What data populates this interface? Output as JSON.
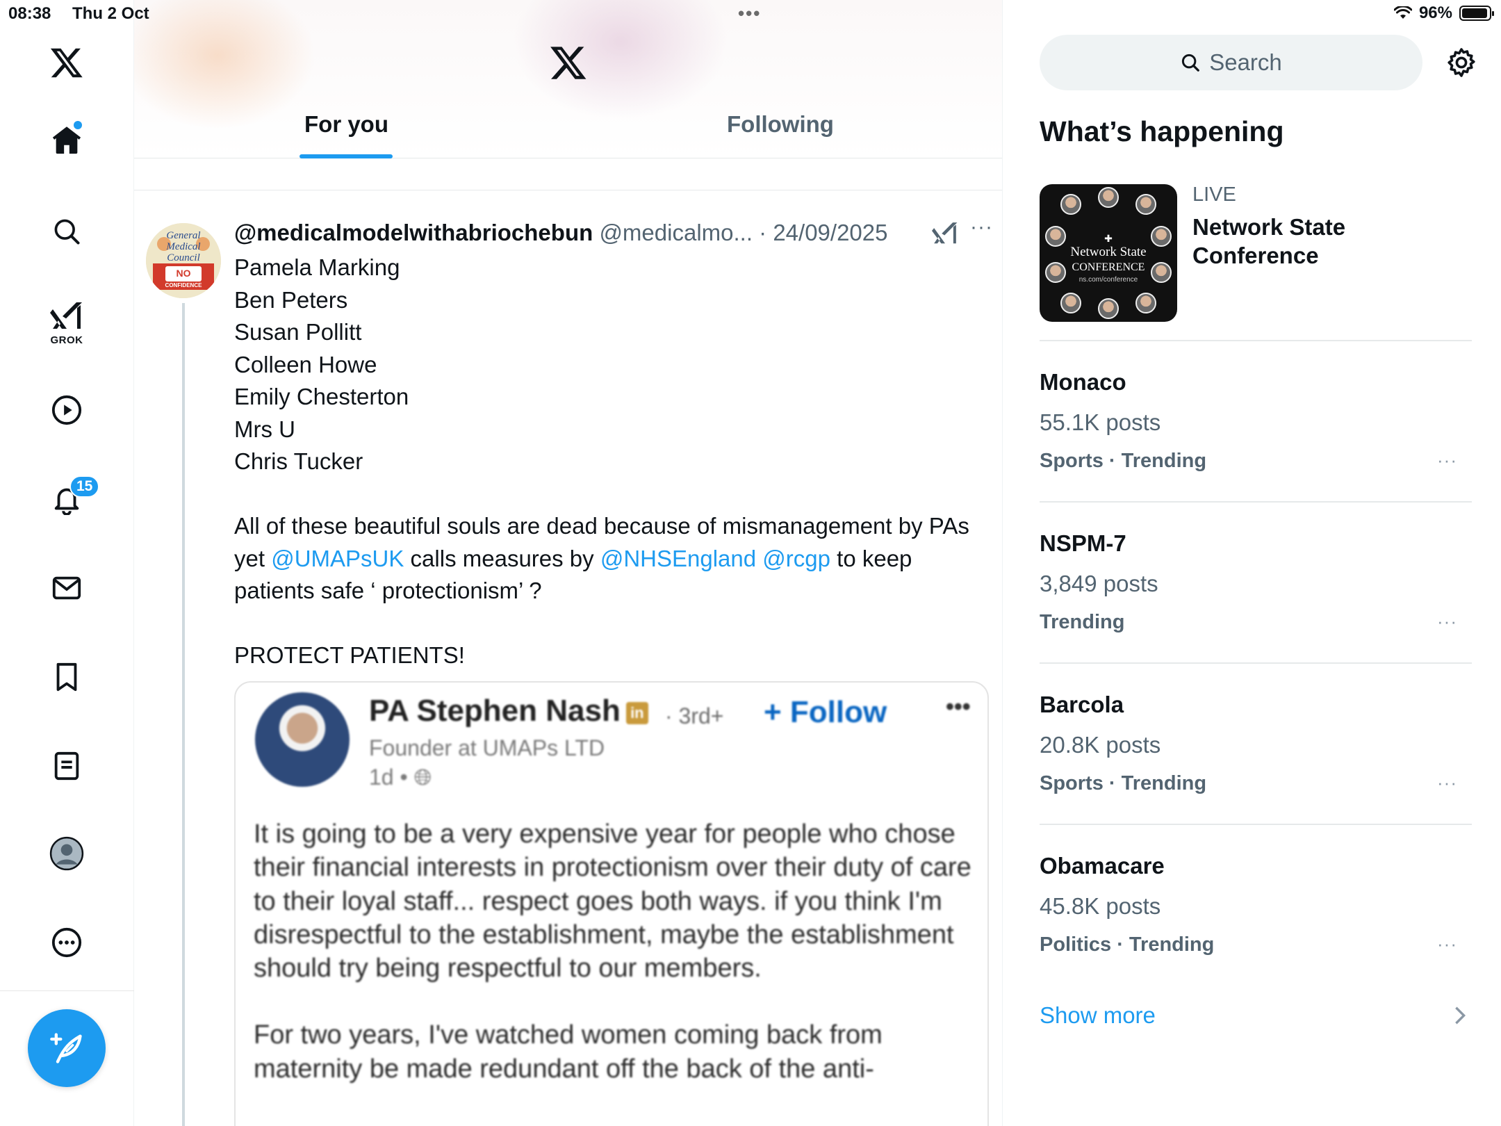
{
  "status_bar": {
    "time": "08:38",
    "date": "Thu 2 Oct",
    "battery": "96%"
  },
  "nav": {
    "grok_label": "GROK",
    "notifications_badge": "15"
  },
  "header": {
    "tabs": [
      {
        "label": "For you",
        "active": true
      },
      {
        "label": "Following",
        "active": false
      }
    ]
  },
  "tweet": {
    "display_name": "@medicalmodelwithabriochebun",
    "handle_date": "@medicalmo... · 24/09/2025",
    "more": "···",
    "names": [
      "Pamela Marking",
      "Ben Peters",
      "Susan Pollitt",
      "Colleen Howe",
      "Emily Chesterton",
      "Mrs U",
      "Chris Tucker"
    ],
    "p1": "All of these beautiful souls are dead  because of mismanagement by PAs yet ",
    "mention1": "@UMAPsUK",
    "p2": " calls measures by ",
    "mention2": "@NHSEngland",
    "mention3": "@rcgp",
    "p3": " to keep patients safe ‘ protectionism’ ?",
    "p4": "PROTECT PATIENTS!",
    "avatar_text": [
      "General",
      "Medical",
      "Council",
      "NO",
      "CONFIDENCE"
    ]
  },
  "embed": {
    "name": "PA Stephen Nash",
    "linkedin_badge": "in",
    "degree": "· 3rd+",
    "follow": "+ Follow",
    "more": "•••",
    "headline": "Founder at UMAPs LTD",
    "time": "1d • ",
    "text1": "It is going to be a very expensive year for people who chose their financial interests in protectionism over their duty of care to their loyal staff... respect goes both ways. if you think I'm disrespectful to the establishment, maybe the establishment should try being respectful to our members.",
    "text2": "For two years, I've watched women coming back from maternity be made redundant off the back of the anti-"
  },
  "sidebar": {
    "search_placeholder": "Search",
    "title": "What’s happening",
    "live": {
      "label": "LIVE",
      "title": "Network State Conference",
      "thumb_title": "Network State",
      "thumb_subtitle": "CONFERENCE",
      "thumb_url": "ns.com/conference"
    },
    "trends": [
      {
        "name": "Monaco",
        "count": "55.1K posts",
        "category": "Sports · Trending"
      },
      {
        "name": "NSPM-7",
        "count": "3,849 posts",
        "category": "Trending"
      },
      {
        "name": "Barcola",
        "count": "20.8K posts",
        "category": "Sports · Trending"
      },
      {
        "name": "Obamacare",
        "count": "45.8K posts",
        "category": "Politics · Trending"
      }
    ],
    "trend_more": "···",
    "show_more": "Show more"
  },
  "colors": {
    "accent": "#1d9bf0",
    "text": "#0f1419",
    "muted": "#536471",
    "linkedin_blue": "#0a66c2"
  }
}
